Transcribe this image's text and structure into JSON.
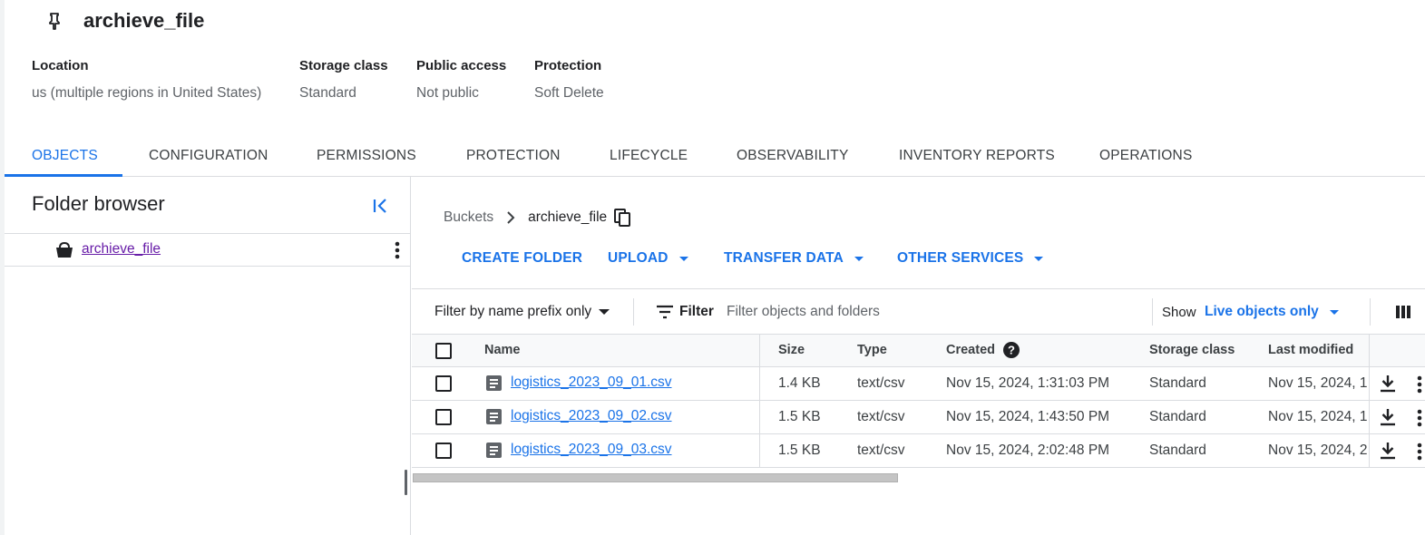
{
  "bucket": {
    "name": "archieve_file"
  },
  "meta": [
    {
      "label": "Location",
      "value": "us (multiple regions in United States)"
    },
    {
      "label": "Storage class",
      "value": "Standard"
    },
    {
      "label": "Public access",
      "value": "Not public"
    },
    {
      "label": "Protection",
      "value": "Soft Delete"
    }
  ],
  "tabs": [
    {
      "label": "OBJECTS",
      "active": true
    },
    {
      "label": "CONFIGURATION"
    },
    {
      "label": "PERMISSIONS"
    },
    {
      "label": "PROTECTION"
    },
    {
      "label": "LIFECYCLE"
    },
    {
      "label": "OBSERVABILITY"
    },
    {
      "label": "INVENTORY REPORTS"
    },
    {
      "label": "OPERATIONS"
    }
  ],
  "folder_browser": {
    "title": "Folder browser",
    "item": "archieve_file"
  },
  "breadcrumb": {
    "root": "Buckets",
    "current": "archieve_file"
  },
  "actions": {
    "create_folder": "CREATE FOLDER",
    "upload": "UPLOAD",
    "transfer_data": "TRANSFER DATA",
    "other_services": "OTHER SERVICES"
  },
  "filter": {
    "mode": "Filter by name prefix only",
    "label": "Filter",
    "placeholder": "Filter objects and folders",
    "show_label": "Show",
    "show_value": "Live objects only"
  },
  "table": {
    "headers": {
      "name": "Name",
      "size": "Size",
      "type": "Type",
      "created": "Created",
      "storage_class": "Storage class",
      "last_modified": "Last modified"
    },
    "rows": [
      {
        "name": "logistics_2023_09_01.csv",
        "size": "1.4 KB",
        "type": "text/csv",
        "created": "Nov 15, 2024, 1:31:03 PM",
        "storage_class": "Standard",
        "last_modified": "Nov 15, 2024, 1"
      },
      {
        "name": "logistics_2023_09_02.csv",
        "size": "1.5 KB",
        "type": "text/csv",
        "created": "Nov 15, 2024, 1:43:50 PM",
        "storage_class": "Standard",
        "last_modified": "Nov 15, 2024, 1"
      },
      {
        "name": "logistics_2023_09_03.csv",
        "size": "1.5 KB",
        "type": "text/csv",
        "created": "Nov 15, 2024, 2:02:48 PM",
        "storage_class": "Standard",
        "last_modified": "Nov 15, 2024, 2"
      }
    ]
  },
  "icons": {
    "pin": "pin-icon",
    "collapse": "collapse-panel-icon",
    "bucket": "bucket-icon",
    "more": "more-vert-icon",
    "chevron": "chevron-right-icon",
    "copy": "copy-icon",
    "filter": "filter-icon",
    "columns": "column-display-icon",
    "help": "help-icon",
    "file": "file-icon",
    "download": "download-icon"
  },
  "colors": {
    "accent": "#1a73e8",
    "visited_link": "#681da8",
    "border": "#dadce0"
  }
}
